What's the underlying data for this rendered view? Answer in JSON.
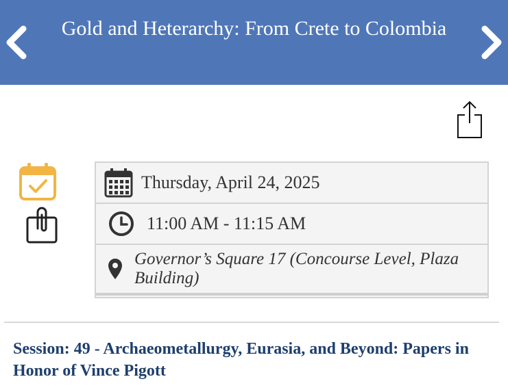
{
  "header": {
    "title": "Gold and Heterarchy: From Crete to Colombia",
    "color": "#4f77b8",
    "back_icon": "chevron-left-icon",
    "forward_icon": "chevron-right-icon"
  },
  "actions": {
    "share_icon": "share-icon",
    "add_to_calendar_icon": "calendar-check-icon",
    "attachment_icon": "paperclip-icon"
  },
  "details": {
    "date": "Thursday, April 24, 2025",
    "time": "11:00 AM - 11:15 AM",
    "location": "Governor’s Square 17 (Concourse Level, Plaza Building)"
  },
  "session": {
    "text": "Session: 49 - Archaeometallurgy, Eurasia, and Beyond: Papers in Honor of Vince Pigott",
    "color": "#1e3f6d"
  },
  "colors": {
    "calendar_accent": "#f2b544",
    "icon_dark": "#333333"
  }
}
